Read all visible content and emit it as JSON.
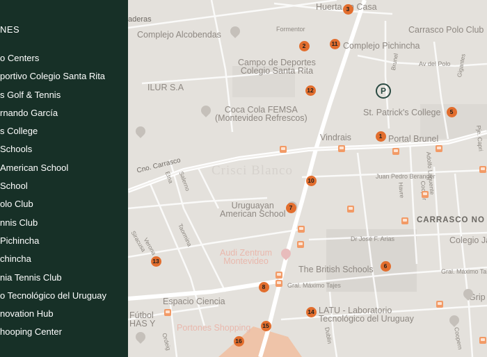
{
  "sidebar": {
    "title": "NES",
    "items": [
      "o Centers",
      "portivo Colegio Santa Rita",
      "s Golf & Tennis",
      "rnando García",
      "s College",
      "Schools",
      "American School",
      "School",
      "olo Club",
      "nnis Club",
      "Pichincha",
      "chincha",
      "nia Tennis Club",
      "o Tecnológico del Uruguay",
      "novation Hub",
      "hooping Center"
    ]
  },
  "map": {
    "watermark": "Crisci Blanco",
    "area_label": "CARRASCO NO",
    "places": {
      "huerta": "Huerta en Casa",
      "carrasco_polo": "Carrasco Polo Club",
      "aderas": "aderas",
      "complejo_alcobendas": "Complejo Alcobendas",
      "formentor": "Formentor",
      "complejo_pichincha": "Complejo Pichincha",
      "campo_deportes": "Campo de Deportes\nColegio Santa Rita",
      "av_polo": "Av del Polo",
      "ilur": "ILUR S.A",
      "coca_cola": "Coca Cola FEMSA\n(Montevideo Refrescos)",
      "st_patricks": "St. Patrick's College",
      "vindrais": "Vindrais",
      "portal_brunel": "Portal Brunel",
      "cno_carrasco": "Cno. Carrasco",
      "juan_pedro": "Juan Pedro Beranger",
      "adolfo": "Adolfo Lapuente",
      "pje_capri": "Pje. Capri",
      "uruguayan_school": "Uruguayan\nAmerican School",
      "dr_jose": "Dr José F. Arias",
      "colegio_ja": "Colegio Ja",
      "audi": "Audi Zentrum\nMontevideo",
      "british": "The British Schools",
      "gral_maximo_right": "Gral. Máximo Ta",
      "gral_maximo": "Gral. Máximo Tajes",
      "espacio_ciencia": "Espacio Ciencia",
      "latu": "LATU - Laboratorio\nTecnológico del Uruguay",
      "futbol": "Fútbol\nHAS Y",
      "portones": "Portones Shopping",
      "grip": "Grip",
      "brunel": "Brunel",
      "gigantes": "Gigantes",
      "havre": "Havre",
      "cooper": "Cooper",
      "etna": "Etna",
      "salerno": "Salerno",
      "taormina": "Taormina",
      "siracusa": "Siracusa",
      "verona": "Verona",
      "ordeig": "Ordeig",
      "dublin": "Dublin",
      "coopern": "Coopern"
    },
    "markers": [
      "1",
      "2",
      "3",
      "5",
      "6",
      "7",
      "8",
      "10",
      "11",
      "12",
      "13",
      "14",
      "15",
      "16"
    ],
    "colors": {
      "marker": "#e26e2e",
      "sidebar": "#173027",
      "map_bg": "#e4e1dc",
      "road": "#ffffff",
      "bus_stop": "#f29a66"
    }
  }
}
